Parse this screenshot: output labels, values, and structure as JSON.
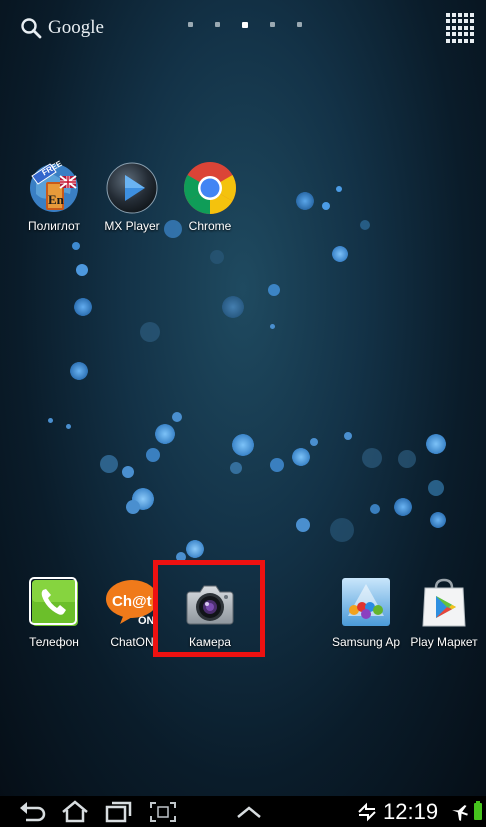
{
  "search": {
    "label": "Google"
  },
  "home_pages": {
    "count": 5,
    "active_index": 2
  },
  "top_apps": [
    {
      "label": "Полиглот",
      "icon": "polyglot-icon"
    },
    {
      "label": "MX Player",
      "icon": "mx-player-icon"
    },
    {
      "label": "Chrome",
      "icon": "chrome-icon"
    }
  ],
  "dock_apps": [
    {
      "label": "Телефон",
      "icon": "phone-icon"
    },
    {
      "label": "ChatON",
      "icon": "chaton-icon"
    },
    {
      "label": "Камера",
      "icon": "camera-icon"
    },
    {
      "label": "Samsung Ap",
      "icon": "samsung-apps-icon"
    },
    {
      "label": "Play Маркет",
      "icon": "play-market-icon"
    }
  ],
  "polyglot_badge": {
    "free": "FREE",
    "lang": "En"
  },
  "chaton_text": {
    "top": "Ch@t",
    "bottom": "ON"
  },
  "status": {
    "time": "12:19"
  },
  "colors": {
    "highlight": "#ee1111",
    "battery": "#46c31d"
  }
}
